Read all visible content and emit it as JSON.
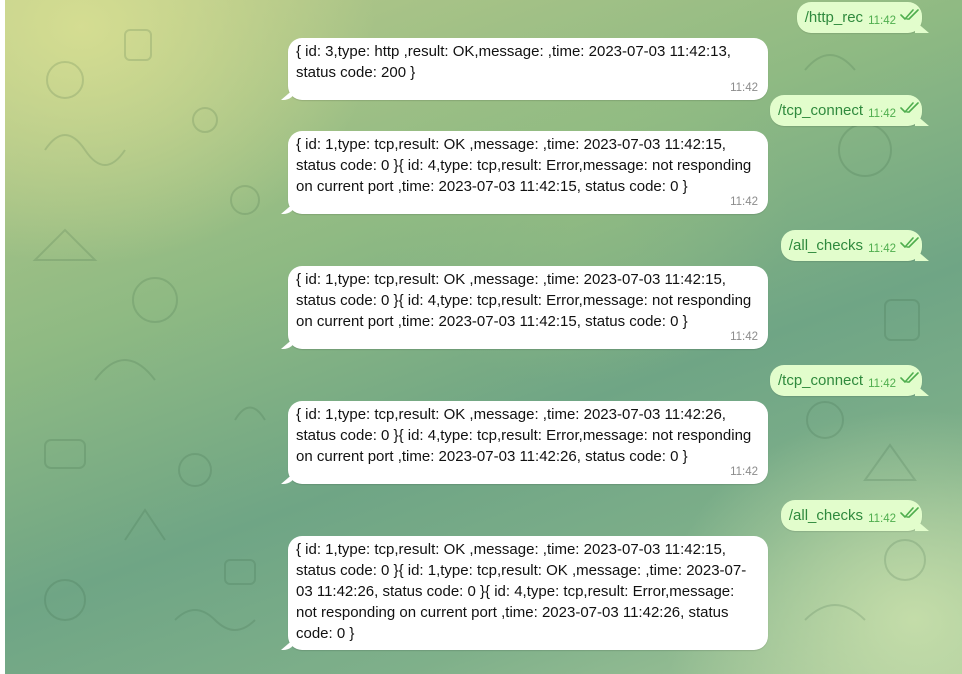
{
  "messages": [
    {
      "dir": "out",
      "text": "/http_rec",
      "time": "11:42"
    },
    {
      "dir": "in",
      "text": "{ id: 3,type: http ,result: OK,message: ,time: 2023-07-03 11:42:13, status code: 200 }",
      "time": "11:42"
    },
    {
      "dir": "out",
      "text": "/tcp_connect",
      "time": "11:42"
    },
    {
      "dir": "in",
      "text": "{ id: 1,type: tcp,result: OK ,message: ,time: 2023-07-03 11:42:15, status code: 0 }{ id: 4,type: tcp,result: Error,message: not responding on current port ,time: 2023-07-03 11:42:15, status code: 0 }",
      "time": "11:42"
    },
    {
      "dir": "out",
      "text": "/all_checks",
      "time": "11:42"
    },
    {
      "dir": "in",
      "text": "{ id: 1,type: tcp,result: OK ,message: ,time: 2023-07-03 11:42:15, status code: 0 }{ id: 4,type: tcp,result: Error,message: not responding on current port ,time: 2023-07-03 11:42:15, status code: 0 }",
      "time": "11:42"
    },
    {
      "dir": "out",
      "text": "/tcp_connect",
      "time": "11:42"
    },
    {
      "dir": "in",
      "text": "{ id: 1,type: tcp,result: OK ,message: ,time: 2023-07-03 11:42:26, status code: 0 }{ id: 4,type: tcp,result: Error,message: not responding on current port ,time: 2023-07-03 11:42:26, status code: 0 }",
      "time": "11:42"
    },
    {
      "dir": "out",
      "text": "/all_checks",
      "time": "11:42"
    },
    {
      "dir": "in",
      "text": "{ id: 1,type: tcp,result: OK ,message: ,time: 2023-07-03 11:42:15, status code: 0 }{ id: 1,type: tcp,result: OK ,message: ,time: 2023-07-03 11:42:26, status code: 0 }{ id: 4,type: tcp,result: Error,message: not responding on current port ,time: 2023-07-03 11:42:26, status code: 0 }",
      "time": ""
    }
  ],
  "icons": {
    "read_status": "double-check-icon"
  },
  "colors": {
    "outgoing_bubble": "#e2fdcc",
    "incoming_bubble": "#ffffff",
    "outgoing_text": "#2f8a3d",
    "checkmark": "#4fae4e"
  }
}
